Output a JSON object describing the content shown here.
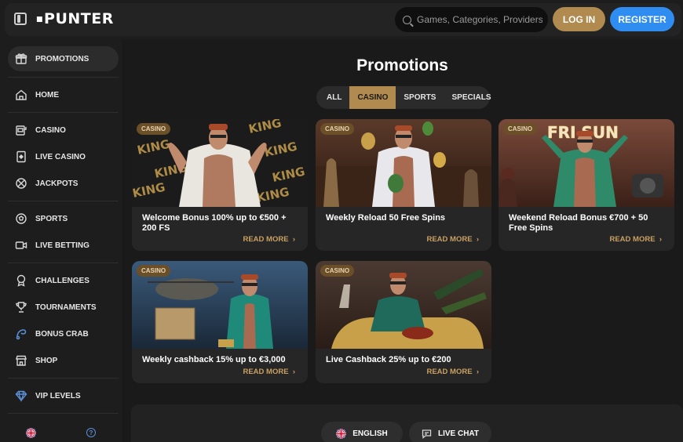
{
  "header": {
    "logo": "PUNTER",
    "search_placeholder": "Games, Categories, Providers",
    "login_label": "LOG IN",
    "register_label": "REGISTER"
  },
  "sidebar": {
    "items": [
      {
        "label": "PROMOTIONS",
        "icon": "gift-icon",
        "active": true
      },
      {
        "label": "HOME",
        "icon": "home-icon"
      },
      {
        "label": "CASINO",
        "icon": "slot-machine-icon"
      },
      {
        "label": "LIVE CASINO",
        "icon": "playing-card-icon"
      },
      {
        "label": "JACKPOTS",
        "icon": "jackpot-icon"
      },
      {
        "label": "SPORTS",
        "icon": "soccer-ball-icon"
      },
      {
        "label": "LIVE BETTING",
        "icon": "video-camera-icon"
      },
      {
        "label": "CHALLENGES",
        "icon": "medal-icon"
      },
      {
        "label": "TOURNAMENTS",
        "icon": "trophy-icon"
      },
      {
        "label": "BONUS CRAB",
        "icon": "crab-icon"
      },
      {
        "label": "SHOP",
        "icon": "shop-icon"
      },
      {
        "label": "VIP LEVELS",
        "icon": "diamond-icon"
      }
    ]
  },
  "main": {
    "title": "Promotions",
    "tabs": [
      {
        "label": "ALL",
        "active": false
      },
      {
        "label": "CASINO",
        "active": true
      },
      {
        "label": "SPORTS",
        "active": false
      },
      {
        "label": "SPECIALS",
        "active": false
      }
    ],
    "cards": [
      {
        "badge": "CASINO",
        "title": "Welcome Bonus 100% up to €500 + 200 FS",
        "cta": "READ MORE"
      },
      {
        "badge": "CASINO",
        "title": "Weekly Reload 50 Free Spins",
        "cta": "READ MORE"
      },
      {
        "badge": "CASINO",
        "title": "Weekend Reload Bonus €700 + 50 Free Spins",
        "cta": "READ MORE"
      },
      {
        "badge": "CASINO",
        "title": "Weekly cashback 15% up to €3,000",
        "cta": "READ MORE"
      },
      {
        "badge": "CASINO",
        "title": "Live Cashback 25% up to €200",
        "cta": "READ MORE"
      }
    ],
    "card_sign_text": "FRI SUN",
    "card_king_text": "KING"
  },
  "footer": {
    "language_label": "ENGLISH",
    "chat_label": "LIVE CHAT"
  },
  "colors": {
    "gold": "#b08a4f",
    "blue": "#2f8cf1",
    "bg": "#1a1a1a"
  }
}
